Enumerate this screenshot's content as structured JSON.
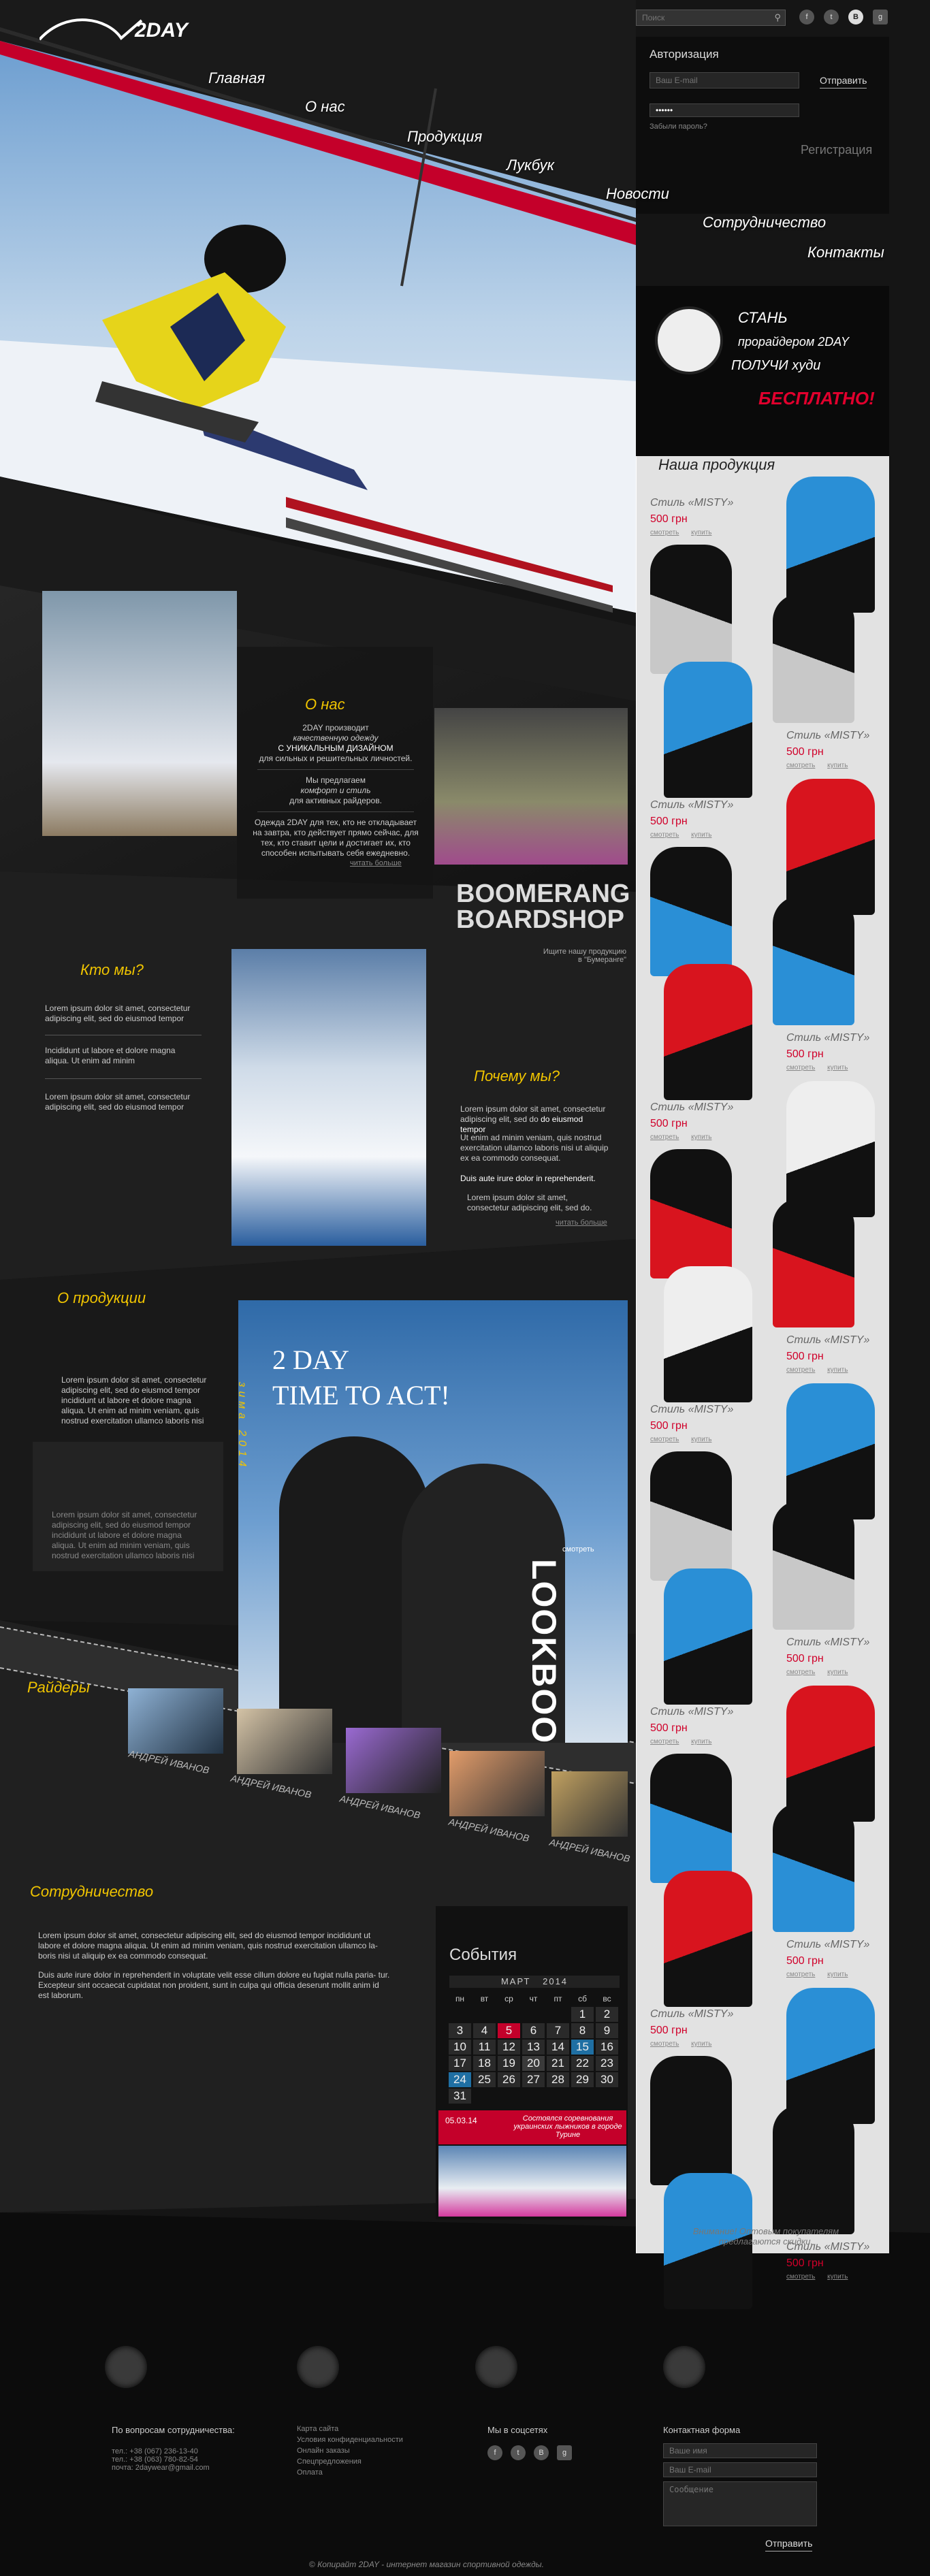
{
  "brand": {
    "logo": "2DAY"
  },
  "search": {
    "placeholder": "Поиск"
  },
  "social": [
    "f",
    "t",
    "В",
    "g"
  ],
  "auth": {
    "title": "Авторизация",
    "email_placeholder": "Ваш E-mail",
    "password_value": "••••••",
    "send": "Отправить",
    "forgot": "Забыли пароль?",
    "register": "Регистрация"
  },
  "menu": [
    "Главная",
    "О нас",
    "Продукция",
    "Лукбук",
    "Новости",
    "Сотрудничество",
    "Контакты"
  ],
  "promo": {
    "line1": "СТАНЬ",
    "line2": "прорайдером 2DAY",
    "line3": "ПОЛУЧИ худи",
    "line4": "БЕСПЛАТНО!"
  },
  "products": {
    "title": "Наша продукция",
    "items": [
      {
        "style": "Стиль «MISTY»",
        "price": "500 грн",
        "view": "смотреть",
        "buy": "купить"
      },
      {
        "style": "Стиль «MISTY»",
        "price": "500 грн",
        "view": "смотреть",
        "buy": "купить"
      },
      {
        "style": "Стиль «MISTY»",
        "price": "500 грн",
        "view": "смотреть",
        "buy": "купить"
      },
      {
        "style": "Стиль «MISTY»",
        "price": "500 грн",
        "view": "смотреть",
        "buy": "купить"
      },
      {
        "style": "Стиль «MISTY»",
        "price": "500 грн",
        "view": "смотреть",
        "buy": "купить"
      },
      {
        "style": "Стиль «MISTY»",
        "price": "500 грн",
        "view": "смотреть",
        "buy": "купить"
      },
      {
        "style": "Стиль «MISTY»",
        "price": "500 грн",
        "view": "смотреть",
        "buy": "купить"
      },
      {
        "style": "Стиль «MISTY»",
        "price": "500 грн",
        "view": "смотреть",
        "buy": "купить"
      },
      {
        "style": "Стиль «MISTY»",
        "price": "500 грн",
        "view": "смотреть",
        "buy": "купить"
      },
      {
        "style": "Стиль «MISTY»",
        "price": "500 грн",
        "view": "смотреть",
        "buy": "купить"
      },
      {
        "style": "Стиль «MISTY»",
        "price": "500 грн",
        "view": "смотреть",
        "buy": "купить"
      },
      {
        "style": "Стиль «MISTY»",
        "price": "500 грн",
        "view": "смотреть",
        "buy": "купить"
      }
    ],
    "notice": "Внимание! Оптовым покупателям предлагаются скидки."
  },
  "about": {
    "title": "О нас",
    "p1": "2DAY производит",
    "p2": "качественную одежду",
    "p3": "С УНИКАЛЬНЫМ ДИЗАЙНОМ",
    "p4": "для сильных и решительных личностей.",
    "p5": "Мы предлагаем",
    "p6": "комфорт и стиль",
    "p7": "для активных райдеров.",
    "p8": "Одежда 2DAY для тех, кто не откладывает на завтра, кто действует прямо сейчас, для тех, кто ставит цели и достигает их, кто способен испытывать себя ежедневно.",
    "more": "читать больше",
    "shop1": "BOOMERANG",
    "shop2": "BOARDSHOP",
    "shop_note1": "Ищите нашу продукцию",
    "shop_note2": "в \"Бумеранге\""
  },
  "who": {
    "title": "Кто мы?",
    "t1": "Lorem ipsum dolor sit amet, consectetur adipiscing elit, sed do eiusmod tempor",
    "t2": "Incididunt ut labore et dolore magna aliqua. Ut enim ad minim",
    "t3": "Lorem ipsum dolor sit amet, consectetur adipiscing elit, sed do eiusmod tempor"
  },
  "why": {
    "title": "Почему мы?",
    "t1": "Lorem ipsum dolor sit amet, consectetur adipiscing elit, sed do",
    "t1b": "do eiusmod tempor",
    "t2": "Ut enim ad minim veniam, quis nostrud exercitation ullamco laboris nisi ut aliquip ex ea commodo consequat.",
    "t3": "Duis aute irure dolor in reprehenderit.",
    "t4": "Lorem ipsum dolor sit amet, consectetur adipiscing elit, sed do.",
    "more": "читать больше"
  },
  "products_about": {
    "title": "О продукции",
    "t1": "Lorem ipsum dolor sit amet, consectetur adipiscing elit, sed do eiusmod tempor incididunt ut labore et dolore magna aliqua. Ut enim ad minim veniam, quis nostrud exercitation ullamco laboris nisi",
    "t2": "Lorem ipsum dolor sit amet, consectetur adipiscing elit, sed do eiusmod tempor incididunt ut labore et dolore magna aliqua. Ut enim ad minim veniam, quis nostrud exercitation ullamco laboris nisi"
  },
  "lookbook": {
    "title1": "2 DAY",
    "title2": "TIME TO ACT!",
    "vertical": "зима 2014",
    "word": "LOOKBOOK",
    "see": "смотреть"
  },
  "riders": {
    "title": "Райдеры",
    "names": [
      "АНДРЕЙ ИВАНОВ",
      "АНДРЕЙ ИВАНОВ",
      "АНДРЕЙ ИВАНОВ",
      "АНДРЕЙ ИВАНОВ",
      "АНДРЕЙ ИВАНОВ"
    ]
  },
  "coop": {
    "title": "Сотрудничество",
    "p1": "Lorem ipsum dolor sit amet, consectetur adipiscing elit, sed do eiusmod tempor incididunt ut labore et dolore magna aliqua. Ut enim ad minim veniam, quis nostrud exercitation ullamco la- boris nisi ut aliquip ex ea commodo consequat.",
    "p2": "Duis aute irure dolor in reprehenderit in voluptate velit esse cillum dolore eu fugiat nulla paria- tur. Excepteur sint occaecat cupidatat non proident, sunt in culpa qui officia deserunt mollit anim id est laborum."
  },
  "events": {
    "title": "События",
    "month": "МАРТ",
    "year": "2014",
    "days": [
      "пн",
      "вт",
      "ср",
      "чт",
      "пт",
      "сб",
      "вс"
    ],
    "weeks": [
      [
        "",
        "",
        "",
        "",
        "",
        "1",
        "2"
      ],
      [
        "3",
        "4",
        "5",
        "6",
        "7",
        "8",
        "9"
      ],
      [
        "10",
        "11",
        "12",
        "13",
        "14",
        "15",
        "16"
      ],
      [
        "17",
        "18",
        "19",
        "20",
        "21",
        "22",
        "23"
      ],
      [
        "24",
        "25",
        "26",
        "27",
        "28",
        "29",
        "30"
      ],
      [
        "31",
        "",
        "",
        "",
        "",
        "",
        ""
      ]
    ],
    "news_date": "05.03.14",
    "news_text": "Состоялся соревнования украинских лыжников в городе Турине"
  },
  "footer": {
    "c1_title": "По вопросам сотрудничества:",
    "c1_l1": "тел.: +38 (067) 236-13-40",
    "c1_l2": "тел.: +38 (063) 780-82-54",
    "c1_l3": "почта: 2daywear@gmail.com",
    "c2": [
      "Карта сайта",
      "Условия конфиденциальности",
      "Онлайн заказы",
      "Спецпредложения",
      "Оплата"
    ],
    "c3_title": "Мы в соцсетях",
    "c4_title": "Контактная форма",
    "name_ph": "Ваше имя",
    "email_ph": "Ваш E-mail",
    "msg_ph": "Сообщение",
    "send": "Отправить",
    "copyright": "Копирайт 2DAY -",
    "copyright2": "интернет магазин спортивной одежды."
  },
  "colors": {
    "accent": "#c4002a",
    "yellow": "#f0c400"
  }
}
